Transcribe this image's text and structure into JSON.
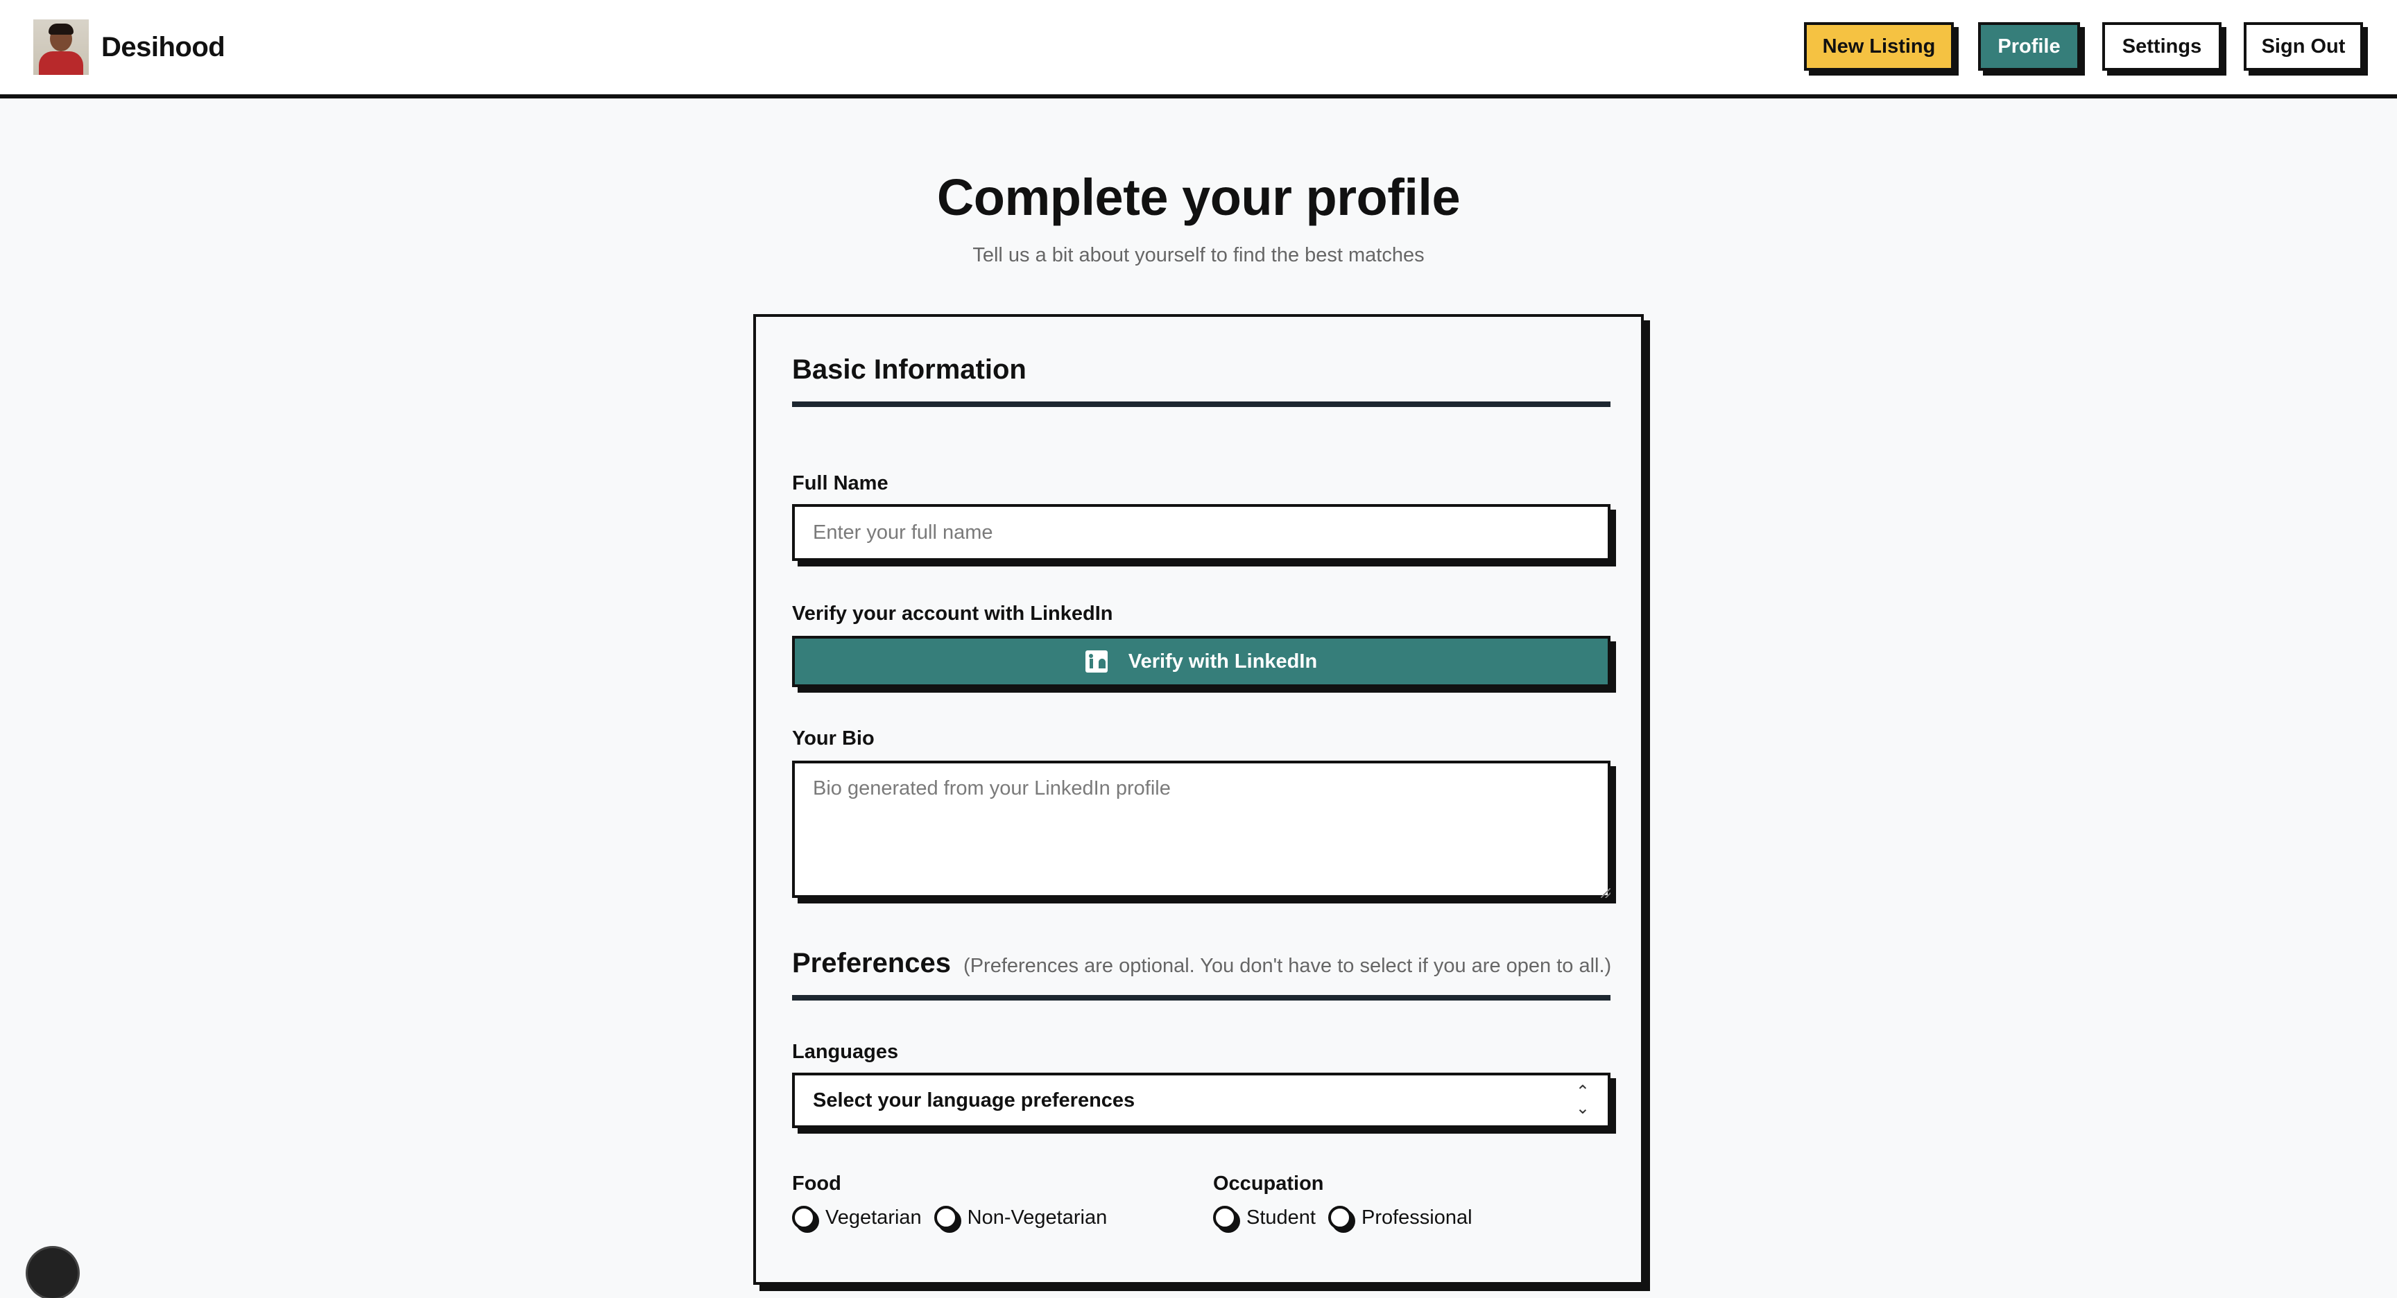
{
  "brand": {
    "name": "Desihood"
  },
  "nav": {
    "new_listing": "New Listing",
    "profile": "Profile",
    "settings": "Settings",
    "sign_out": "Sign Out"
  },
  "header": {
    "title": "Complete your profile",
    "subtitle": "Tell us a bit about yourself to find the best matches"
  },
  "form": {
    "basic_section_title": "Basic Information",
    "full_name": {
      "label": "Full Name",
      "placeholder": "Enter your full name",
      "value": ""
    },
    "linkedin": {
      "label": "Verify your account with LinkedIn",
      "button": "Verify with LinkedIn"
    },
    "bio": {
      "label": "Your Bio",
      "placeholder": "Bio generated from your LinkedIn profile",
      "value": ""
    },
    "preferences": {
      "title": "Preferences",
      "note": "(Preferences are optional. You don't have to select if you are open to all.)",
      "languages": {
        "label": "Languages",
        "selected": "Select your language preferences"
      },
      "food": {
        "label": "Food",
        "options": [
          "Vegetarian",
          "Non-Vegetarian"
        ]
      },
      "occupation": {
        "label": "Occupation",
        "options": [
          "Student",
          "Professional"
        ]
      }
    }
  },
  "colors": {
    "accent_yellow": "#f5c242",
    "accent_teal": "#367e7a",
    "border": "#111111",
    "background": "#f8f9fa"
  },
  "icons": [
    "linkedin-icon",
    "chevron-up-down-icon",
    "avatar"
  ]
}
